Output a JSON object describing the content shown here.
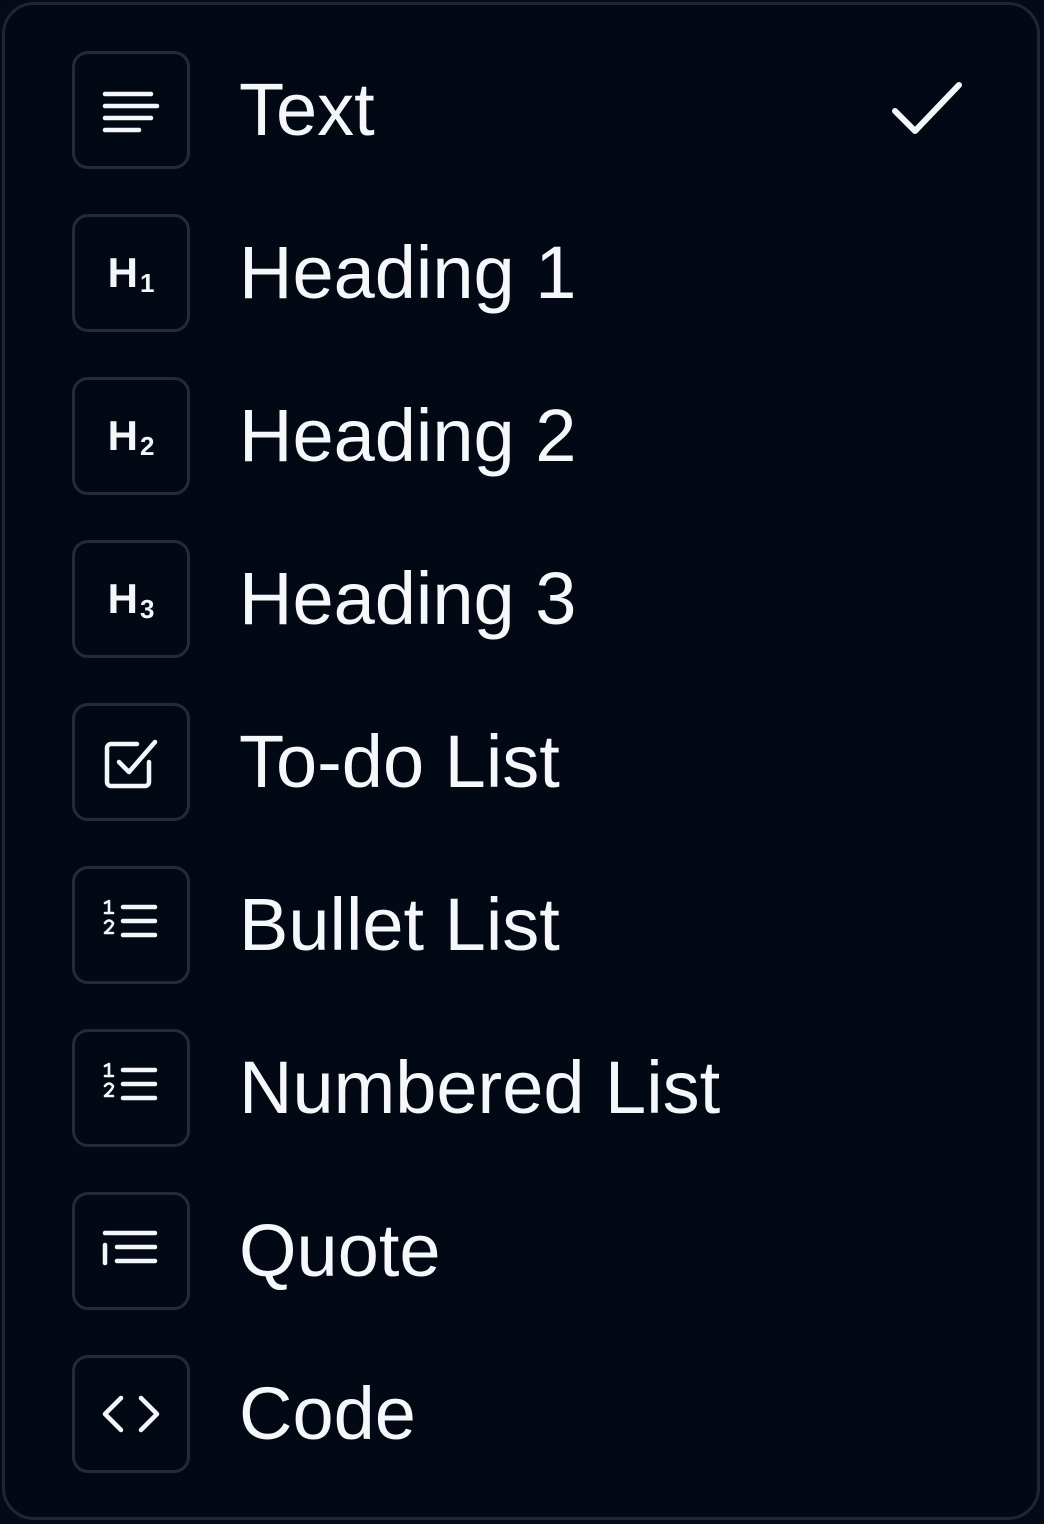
{
  "menu": {
    "selected_index": 0,
    "items": [
      {
        "label": "Text",
        "icon": "text-align-icon",
        "selected": true
      },
      {
        "label": "Heading 1",
        "icon": "heading-1-icon",
        "icon_text": "H",
        "icon_sub": "1",
        "selected": false
      },
      {
        "label": "Heading 2",
        "icon": "heading-2-icon",
        "icon_text": "H",
        "icon_sub": "2",
        "selected": false
      },
      {
        "label": "Heading 3",
        "icon": "heading-3-icon",
        "icon_text": "H",
        "icon_sub": "3",
        "selected": false
      },
      {
        "label": "To-do List",
        "icon": "checkbox-icon",
        "selected": false
      },
      {
        "label": "Bullet List",
        "icon": "list-ordered-icon",
        "selected": false
      },
      {
        "label": "Numbered List",
        "icon": "list-ordered-icon",
        "selected": false
      },
      {
        "label": "Quote",
        "icon": "quote-icon",
        "selected": false
      },
      {
        "label": "Code",
        "icon": "code-icon",
        "selected": false
      }
    ]
  },
  "colors": {
    "background": "#030914",
    "border": "#1e2633",
    "text": "#f6f7fa",
    "icon_border": "#222b38"
  }
}
